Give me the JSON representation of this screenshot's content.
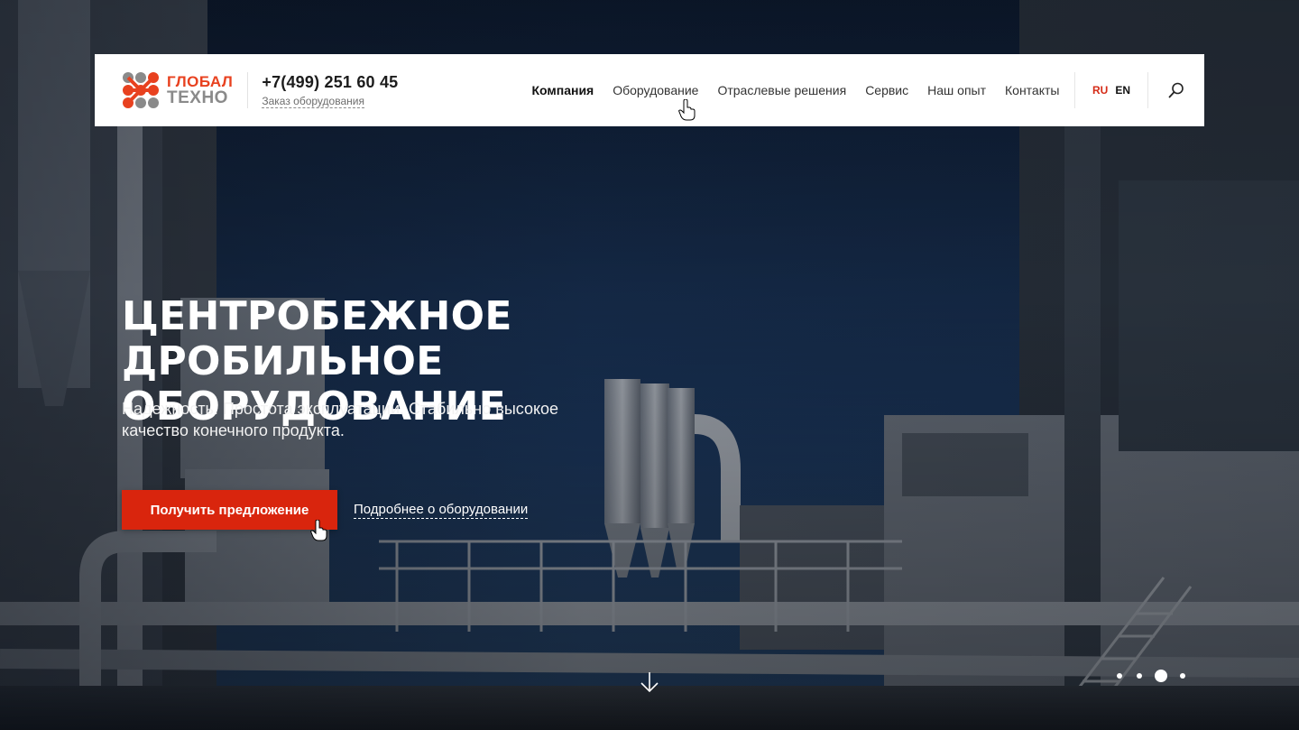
{
  "brand": {
    "name_top": "ГЛОБАЛ",
    "name_bottom": "ТЕХНО",
    "accent_color": "#e8411f",
    "muted_color": "#8a8a8a"
  },
  "contact": {
    "phone": "+7(499) 251 60 45",
    "order_link": "Заказ оборудования"
  },
  "nav": {
    "items": [
      {
        "label": "Компания",
        "active": true
      },
      {
        "label": "Оборудование",
        "active": false
      },
      {
        "label": "Отраслевые решения",
        "active": false
      },
      {
        "label": "Сервис",
        "active": false
      },
      {
        "label": "Наш опыт",
        "active": false
      },
      {
        "label": "Контакты",
        "active": false
      }
    ]
  },
  "lang": {
    "items": [
      {
        "label": "RU",
        "active": true
      },
      {
        "label": "EN",
        "active": false
      }
    ]
  },
  "search": {
    "icon": "search-icon"
  },
  "hero": {
    "title_line1": "ЦЕНТРОБЕЖНОЕ ДРОБИЛЬНОЕ",
    "title_line2": "ОБОРУДОВАНИЕ",
    "subtitle": "Надежность. Простота эксплуатации. Стабильно высокое качество конечного продукта.",
    "cta_primary": "Получить предложение",
    "cta_secondary": "Подробнее о оборудовании",
    "cta_color": "#d9250d"
  },
  "scroll": {
    "icon": "arrow-down-icon"
  },
  "slider": {
    "total": 4,
    "active_index": 2
  }
}
